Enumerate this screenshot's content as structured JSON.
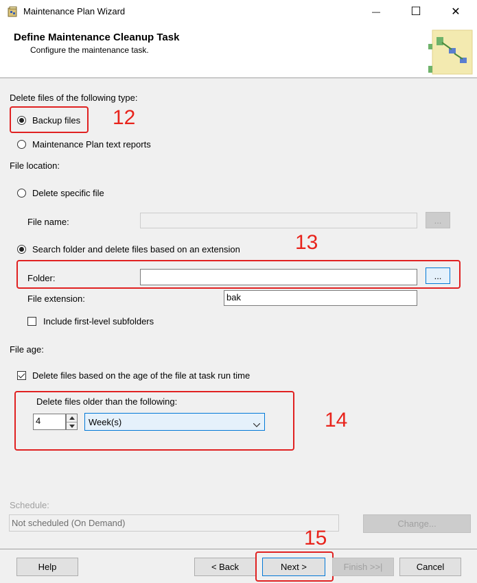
{
  "window": {
    "title": "Maintenance Plan Wizard",
    "minimize_glyph": "—",
    "maximize_glyph": "☐",
    "close_glyph": "✕"
  },
  "header": {
    "title": "Define Maintenance Cleanup Task",
    "subtitle": "Configure the maintenance task."
  },
  "file_type": {
    "group_label": "Delete files of the following type:",
    "backup_files": "Backup files",
    "text_reports": "Maintenance Plan text reports",
    "selected": "Backup files"
  },
  "file_location": {
    "group_label": "File location:",
    "delete_specific_file": "Delete specific file",
    "file_name_label": "File name:",
    "file_name_value": "",
    "file_browse": "...",
    "search_folder": "Search folder and delete files based on an extension",
    "folder_label": "Folder:",
    "folder_value": "",
    "folder_browse": "...",
    "extension_label": "File extension:",
    "extension_value": "bak",
    "include_subfolders": "Include first-level subfolders",
    "include_subfolders_checked": false,
    "selected": "Search folder and delete files based on an extension"
  },
  "file_age": {
    "group_label": "File age:",
    "delete_by_age": "Delete files based on the age of the file at task run time",
    "delete_by_age_checked": true,
    "older_than_label": "Delete files older than the following:",
    "count_value": "4",
    "unit_value": "Week(s)"
  },
  "schedule": {
    "label": "Schedule:",
    "value": "Not scheduled (On Demand)",
    "change_button": "Change..."
  },
  "footer": {
    "help": "Help",
    "back": "< Back",
    "next": "Next >",
    "finish": "Finish >>|",
    "cancel": "Cancel"
  },
  "annotations": [
    "12",
    "13",
    "14",
    "15"
  ],
  "colors": {
    "annotation_red": "#e8231b",
    "focus_blue": "#0078d7"
  }
}
